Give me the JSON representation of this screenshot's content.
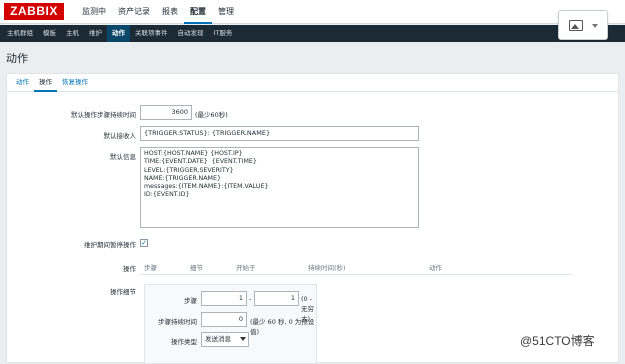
{
  "header": {
    "logo": "ZABBIX",
    "main_menu": [
      {
        "label": "监测中",
        "active": false
      },
      {
        "label": "资产记录",
        "active": false
      },
      {
        "label": "报表",
        "active": false
      },
      {
        "label": "配置",
        "active": true
      },
      {
        "label": "管理",
        "active": false
      }
    ],
    "sub_menu": [
      {
        "label": "主机群组",
        "active": false
      },
      {
        "label": "模板",
        "active": false
      },
      {
        "label": "主机",
        "active": false
      },
      {
        "label": "维护",
        "active": false
      },
      {
        "label": "动作",
        "active": true
      },
      {
        "label": "关联项事件",
        "active": false
      },
      {
        "label": "自动发现",
        "active": false
      },
      {
        "label": "IT服务",
        "active": false
      }
    ],
    "user_menu_icon": "image-icon"
  },
  "page": {
    "title": "动作"
  },
  "tabs": [
    {
      "label": "动作",
      "active": false
    },
    {
      "label": "操作",
      "active": true
    },
    {
      "label": "恢复操作",
      "active": false
    }
  ],
  "form": {
    "default_step_duration_label": "默认操作步骤持续时间",
    "default_step_duration_value": "3600",
    "default_step_duration_hint": "(最少60秒)",
    "default_recipient_label": "默认接收人",
    "default_recipient_value": "{TRIGGER.STATUS}: {TRIGGER.NAME}",
    "default_message_label": "默认信息",
    "default_message_value": "HOST:{HOST.NAME} {HOST.IP}\nTIME:{EVENT.DATE}  {EVENT.TIME}\nLEVEL:{TRIGGER.SEVERITY}\nNAME:{TRIGGER.NAME}\nmessages:{ITEM.NAME}:{ITEM.VALUE}\nID:{EVENT.ID}",
    "pause_label": "维护期间暂停操作",
    "pause_checked": true,
    "pause_check_glyph": "✓",
    "operations_label": "操作",
    "operations_columns": [
      "步骤",
      "细节",
      "开始于",
      "持续时间(秒)",
      "动作"
    ],
    "operation_details_label": "操作细节",
    "steps_label": "步骤",
    "steps_from": "1",
    "steps_separator": "-",
    "steps_to": "1",
    "steps_hint": "(0 - 无穷大)",
    "step_duration_label": "步骤持续时间",
    "step_duration_value": "0",
    "step_duration_hint": "(最少 60 秒, 0 为预设值)",
    "operation_type_label": "操作类型",
    "operation_type_value": "发送消息"
  },
  "watermark": "@51CTO博客"
}
